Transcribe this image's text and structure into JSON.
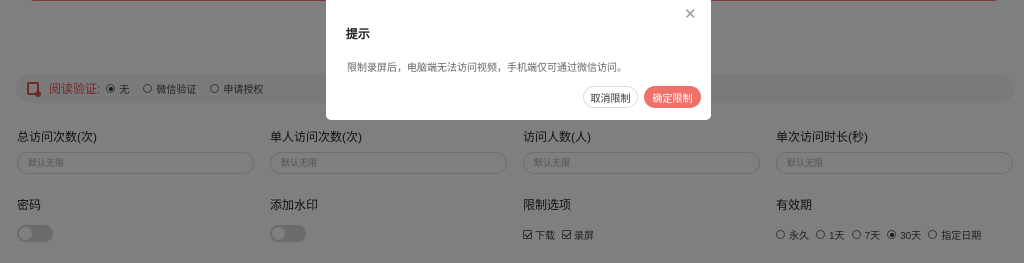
{
  "read_verify": {
    "label": "阅读验证:",
    "options": [
      {
        "label": "无",
        "selected": true
      },
      {
        "label": "微信验证",
        "selected": false
      },
      {
        "label": "申请授权",
        "selected": false
      }
    ]
  },
  "limits": {
    "total_visits": {
      "label": "总访问次数(次)",
      "placeholder": "默认无限"
    },
    "per_person_visits": {
      "label": "单人访问次数(次)",
      "placeholder": "默认无限"
    },
    "visitor_count": {
      "label": "访问人数(人)",
      "placeholder": "默认无限"
    },
    "single_duration": {
      "label": "单次访问时长(秒)",
      "placeholder": "默认无限"
    }
  },
  "password": {
    "label": "密码",
    "enabled": false
  },
  "watermark": {
    "label": "添加水印",
    "enabled": false
  },
  "restrictions": {
    "label": "限制选项",
    "options": [
      {
        "label": "下载",
        "checked": true
      },
      {
        "label": "录屏",
        "checked": true
      }
    ]
  },
  "validity": {
    "label": "有效期",
    "options": [
      {
        "label": "永久",
        "selected": false
      },
      {
        "label": "1天",
        "selected": false
      },
      {
        "label": "7天",
        "selected": false
      },
      {
        "label": "30天",
        "selected": true
      },
      {
        "label": "指定日期",
        "selected": false
      }
    ]
  },
  "dialog": {
    "title": "提示",
    "close_icon": "close-icon",
    "message": "限制录屏后，电脑端无法访问视频，手机端仅可通过微信访问。",
    "cancel_label": "取消限制",
    "confirm_label": "确定限制"
  },
  "colors": {
    "accent": "#e0534a",
    "confirm_button": "#f0706a",
    "overlay": "rgba(0,0,0,0.5)"
  }
}
